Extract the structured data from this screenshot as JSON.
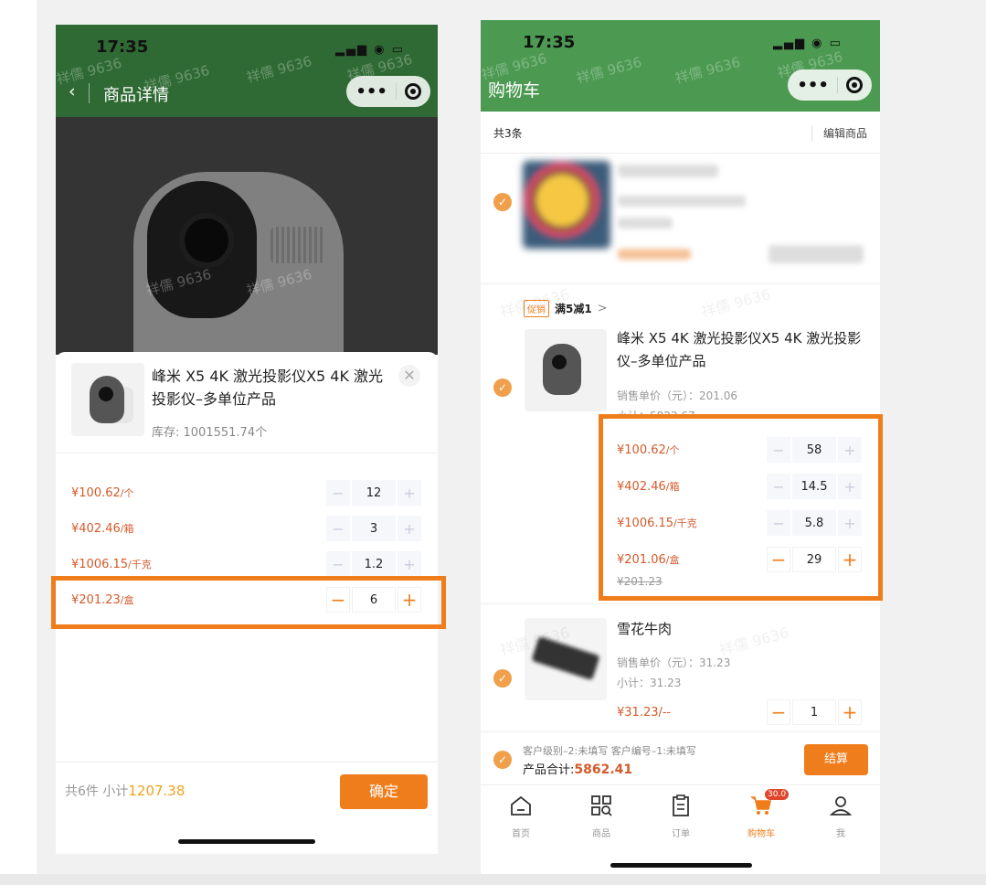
{
  "left_phone": {
    "status_time": "17:35",
    "status_icons": "▂▄▆ ◉ ▭",
    "nav_title": "商品详情",
    "back_icon": "‹",
    "watermark": "祥儒 9636",
    "sheet": {
      "title": "峰米 X5 4K 激光投影仪X5 4K 激光投影仪–多单位产品",
      "close": "✕",
      "stock": "库存: 1001551.74个",
      "rows": [
        {
          "price": "¥100.62",
          "unit": "/个",
          "qty": "12"
        },
        {
          "price": "¥402.46",
          "unit": "/箱",
          "qty": "3"
        },
        {
          "price": "¥1006.15",
          "unit": "/千克",
          "qty": "1.2"
        },
        {
          "price": "¥201.23",
          "unit": "/盒",
          "qty": "6"
        }
      ],
      "minus": "−",
      "plus": "+",
      "total_prefix": "共6件  小计",
      "total_amount": "1207.38",
      "confirm": "确定"
    }
  },
  "right_phone": {
    "status_time": "17:35",
    "status_icons": "▂▄▆ ◉ ▭",
    "nav_title": "购物车",
    "watermark": "祥儒 9636",
    "cart_count": "共3条",
    "edit_label": "编辑商品",
    "check_mark": "✓",
    "promo": {
      "tag": "促销",
      "text": "满5减1",
      "arrow": ">"
    },
    "item2": {
      "title": "峰米 X5 4K 激光投影仪X5 4K 激光投影仪–多单位产品",
      "unit_price": "销售单价（元）：201.06",
      "subtotal": "小计：5823.67",
      "rows": [
        {
          "price": "¥100.62",
          "unit": "/个",
          "qty": "58"
        },
        {
          "price": "¥402.46",
          "unit": "/箱",
          "qty": "14.5"
        },
        {
          "price": "¥1006.15",
          "unit": "/千克",
          "qty": "5.8"
        },
        {
          "price": "¥201.06",
          "unit": "/盒",
          "qty": "29"
        }
      ],
      "original_price": "¥201.23"
    },
    "item3": {
      "title": "雪花牛肉",
      "unit_price": "销售单价（元）：31.23",
      "subtotal": "小计：31.23",
      "price": "¥31.23/--",
      "qty": "1"
    },
    "minus": "−",
    "plus": "+",
    "checkout": {
      "info": "客户级别–2:未填写  客户编号–1:未填写",
      "total_label": "产品合计:",
      "total_amount": "5862.41",
      "settle": "结算"
    },
    "tabs": [
      {
        "label": "首页",
        "icon": "home-icon"
      },
      {
        "label": "商品",
        "icon": "grid-search-icon"
      },
      {
        "label": "订单",
        "icon": "clipboard-icon"
      },
      {
        "label": "购物车",
        "icon": "cart-icon",
        "badge": "30.0"
      },
      {
        "label": "我",
        "icon": "user-icon"
      }
    ]
  },
  "colors": {
    "accent": "#f07d1c",
    "price": "#d45a2a",
    "header_green": "#4c9a52"
  }
}
